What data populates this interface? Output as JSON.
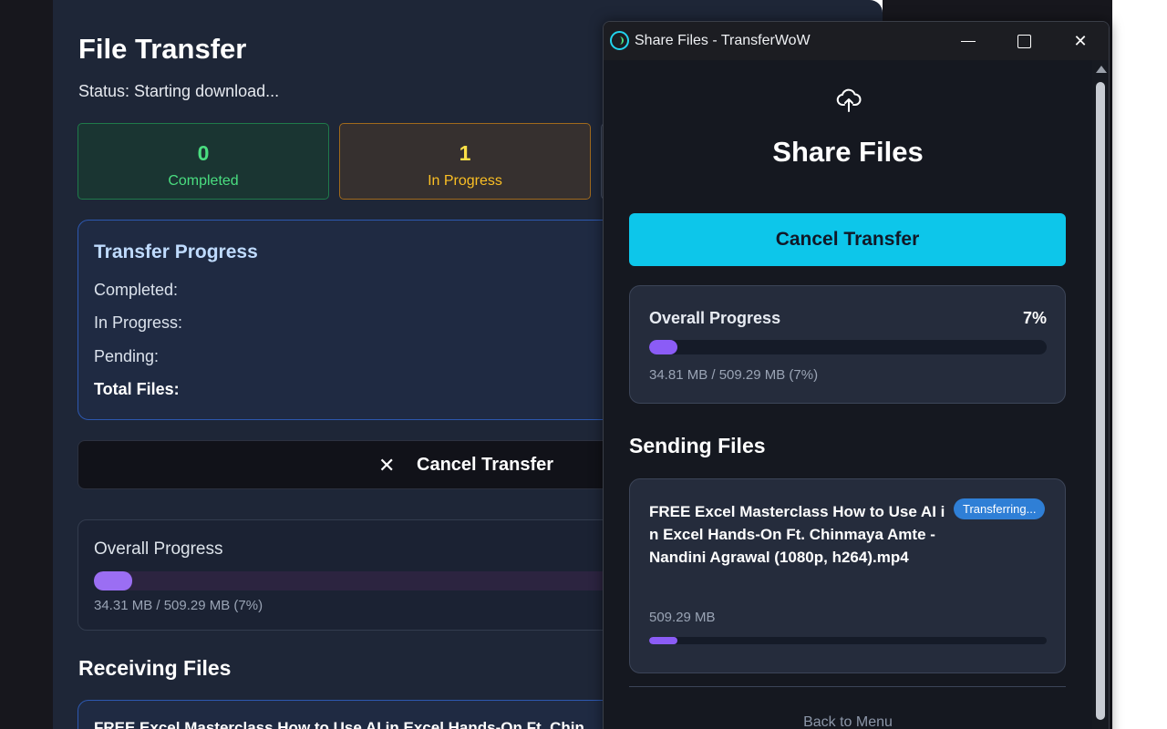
{
  "back_window": {
    "title": "File Transfer",
    "status": "Status: Starting download...",
    "stats": [
      {
        "value": "0",
        "label": "Completed"
      },
      {
        "value": "1",
        "label": "In Progress"
      }
    ],
    "transfer_progress": {
      "heading": "Transfer Progress",
      "rows": [
        "Completed:",
        "In Progress:",
        "Pending:",
        "Total Files:"
      ]
    },
    "cancel_label": "Cancel Transfer",
    "cancel_icon": "close-icon",
    "overall": {
      "label": "Overall Progress",
      "size": "34.31 MB / 509.29 MB (7%)",
      "fraction": 0.07
    },
    "receiving_heading": "Receiving Files",
    "receiving_file": "FREE Excel Masterclass How to Use AI in Excel Hands-On Ft. Chin"
  },
  "window": {
    "title": "Share Files - TransferWoW",
    "controls": {
      "minimize": "minimize-icon",
      "maximize": "maximize-icon",
      "close": "✕"
    }
  },
  "share": {
    "icon": "cloud-upload-icon",
    "title": "Share Files",
    "cancel_label": "Cancel Transfer",
    "overall": {
      "label": "Overall Progress",
      "percent": "7%",
      "size": "34.81 MB / 509.29 MB (7%)",
      "fraction": 0.07
    },
    "sending_heading": "Sending Files",
    "file": {
      "name": "FREE Excel Masterclass How to Use AI in Excel Hands-On Ft. Chinmaya Amte - Nandini Agrawal (1080p, h264).mp4",
      "status": "Transferring...",
      "size": "509.29 MB",
      "fraction": 0.07
    },
    "back_label": "Back to Menu"
  },
  "colors": {
    "accent": "#0dc6ea",
    "progress": "#8b5cf6",
    "badge": "#2f7fd6",
    "success": "#4ade80",
    "warning": "#fbbf24"
  }
}
